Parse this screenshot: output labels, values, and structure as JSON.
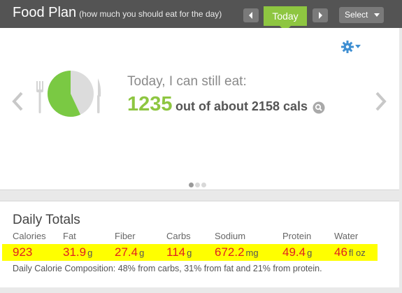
{
  "header": {
    "title": "Food Plan",
    "subtitle": "(how much you should eat for the day)",
    "today_label": "Today",
    "select_label": "Select"
  },
  "main": {
    "headline": "Today, I can still eat:",
    "remaining_cals": "1235",
    "out_of_text": "out of about 2158 cals",
    "plate_consumed_fraction": 0.43,
    "carousel_pages": 3,
    "carousel_active": 1
  },
  "totals": {
    "title": "Daily Totals",
    "items": [
      {
        "label": "Calories",
        "value": "923",
        "unit": ""
      },
      {
        "label": "Fat",
        "value": "31.9",
        "unit": "g"
      },
      {
        "label": "Fiber",
        "value": "27.4",
        "unit": "g"
      },
      {
        "label": "Carbs",
        "value": "114",
        "unit": "g"
      },
      {
        "label": "Sodium",
        "value": "672.2",
        "unit": "mg"
      },
      {
        "label": "Protein",
        "value": "49.4",
        "unit": "g"
      },
      {
        "label": "Water",
        "value": "46",
        "unit": "fl oz"
      }
    ],
    "composition": "Daily Calorie Composition: 48% from carbs, 31% from fat and 21% from protein."
  },
  "colors": {
    "header_bg": "#545454",
    "accent_green": "#8ec641",
    "highlight_yellow": "#ffff00",
    "value_red": "#e02020",
    "gear_blue": "#3f8fd2"
  },
  "icons": [
    "chevron-left-icon",
    "chevron-right-icon",
    "gear-icon",
    "fork-icon",
    "knife-icon",
    "magnifier-icon"
  ]
}
